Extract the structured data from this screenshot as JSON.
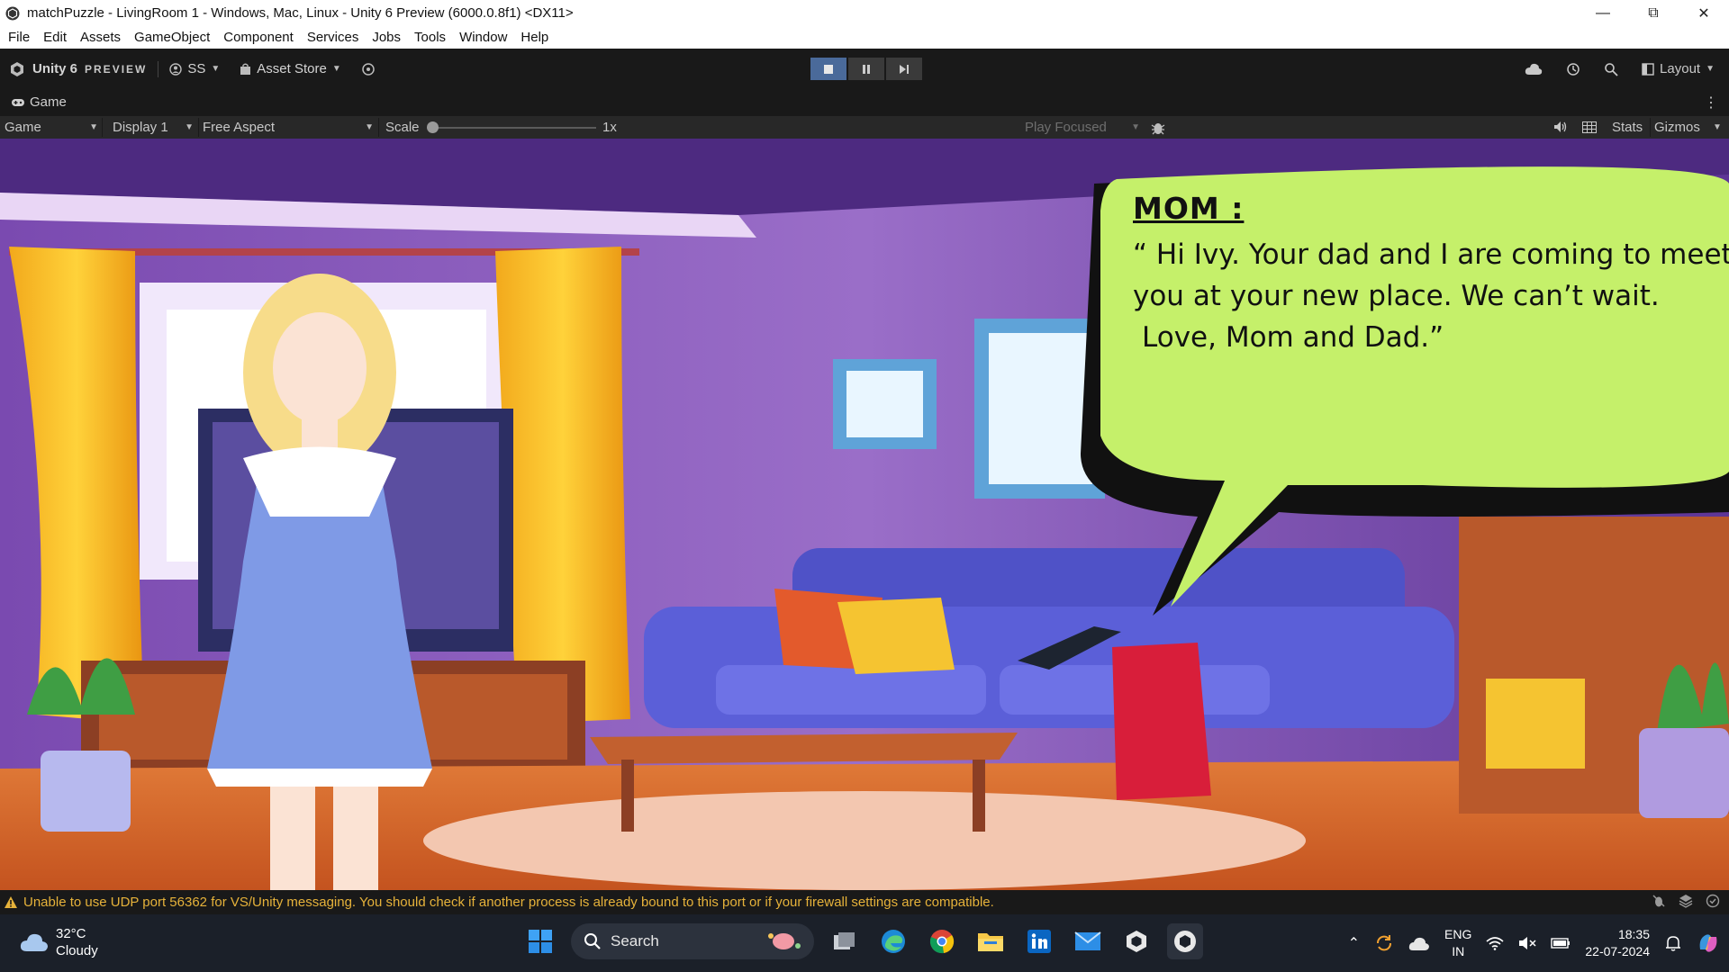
{
  "window": {
    "title": "matchPuzzle - LivingRoom 1 - Windows, Mac, Linux - Unity 6 Preview (6000.0.8f1) <DX11>"
  },
  "menu": [
    "File",
    "Edit",
    "Assets",
    "GameObject",
    "Component",
    "Services",
    "Jobs",
    "Tools",
    "Window",
    "Help"
  ],
  "toolbar": {
    "brand": "Unity 6",
    "preview": "PREVIEW",
    "account": "SS",
    "asset_store": "Asset Store",
    "layout": "Layout"
  },
  "game_tab": {
    "label": "Game"
  },
  "game_bar": {
    "mode": "Game",
    "display": "Display 1",
    "aspect": "Free Aspect",
    "scale_label": "Scale",
    "scale_value": "1x",
    "play_focused": "Play Focused",
    "stats": "Stats",
    "gizmos": "Gizmos"
  },
  "dialogue": {
    "speaker": "MOM :",
    "line1": "“ Hi Ivy. Your dad and I are  coming to meet",
    "line2": "you at your new place. We can’t wait.",
    "line3": "Love, Mom and Dad.”"
  },
  "status": {
    "message": "Unable to use UDP port 56362 for VS/Unity messaging. You should check if another process is already bound to this port or if your firewall settings are compatible."
  },
  "taskbar": {
    "temperature": "32°C",
    "condition": "Cloudy",
    "search_placeholder": "Search",
    "lang_top": "ENG",
    "lang_bottom": "IN",
    "time": "18:35",
    "date": "22-07-2024"
  },
  "colors": {
    "speech_bubble": "#c5f06a",
    "warning": "#e6b23a",
    "room_wall": "#6a3d9e",
    "sofa": "#5b5fd8",
    "floor": "#d8632e"
  }
}
